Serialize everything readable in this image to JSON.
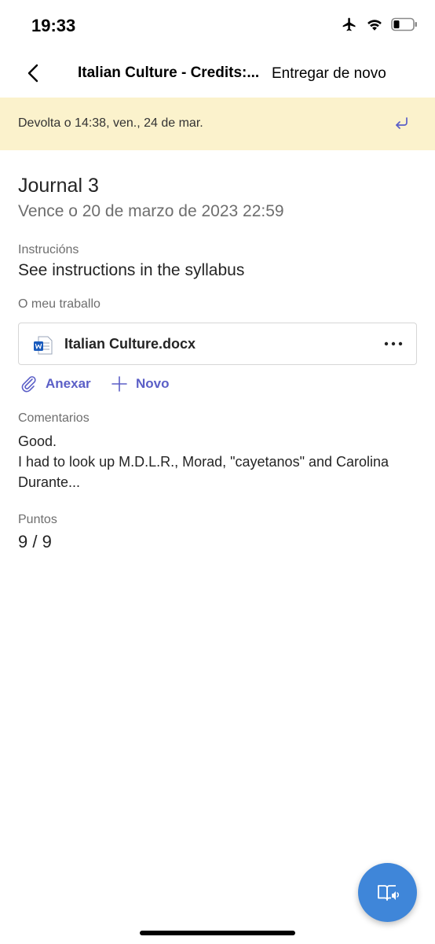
{
  "status_bar": {
    "time": "19:33",
    "icons": [
      "airplane-icon",
      "wifi-icon",
      "battery-icon"
    ]
  },
  "nav": {
    "title": "Italian Culture - Credits:...",
    "action_label": "Entregar de novo"
  },
  "banner": {
    "text": "Devolta o 14:38, ven., 24 de mar.",
    "icon": "undo-icon"
  },
  "assignment": {
    "title": "Journal 3",
    "due": "Vence o 20 de marzo de 2023 22:59"
  },
  "instructions": {
    "label": "Instrucións",
    "text": "See instructions in the syllabus"
  },
  "my_work": {
    "label": "O meu traballo",
    "file_name": "Italian Culture.docx",
    "attach_label": "Anexar",
    "new_label": "Novo"
  },
  "feedback": {
    "label": "Comentarios",
    "lines": [
      "Good.",
      "I had to look up M.D.L.R., Morad, \"cayetanos\" and Carolina",
      "Durante..."
    ]
  },
  "points": {
    "label": "Puntos",
    "value": "9 / 9"
  },
  "colors": {
    "accent": "#5b5fc7",
    "banner_bg": "#fbf2cc",
    "fab_bg": "#3f86d9",
    "word_blue": "#185abd"
  }
}
